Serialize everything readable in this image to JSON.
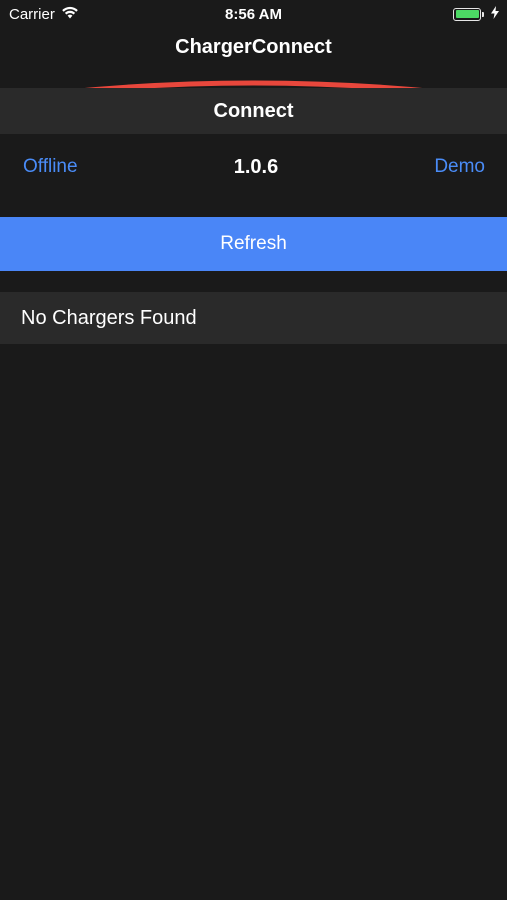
{
  "status_bar": {
    "carrier": "Carrier",
    "time": "8:56 AM",
    "battery_level": 1.0,
    "battery_color": "#4cd964",
    "icons": [
      "wifi-icon",
      "battery-icon",
      "charging-bolt-icon"
    ]
  },
  "nav": {
    "title": "ChargerConnect",
    "accent_color": "#e8473c"
  },
  "section": {
    "header": "Connect"
  },
  "info": {
    "status": "Offline",
    "version": "1.0.6",
    "demo_label": "Demo",
    "link_color": "#4a8cf7"
  },
  "actions": {
    "refresh_label": "Refresh",
    "refresh_color": "#4a86f7"
  },
  "list": {
    "empty_message": "No Chargers Found"
  }
}
